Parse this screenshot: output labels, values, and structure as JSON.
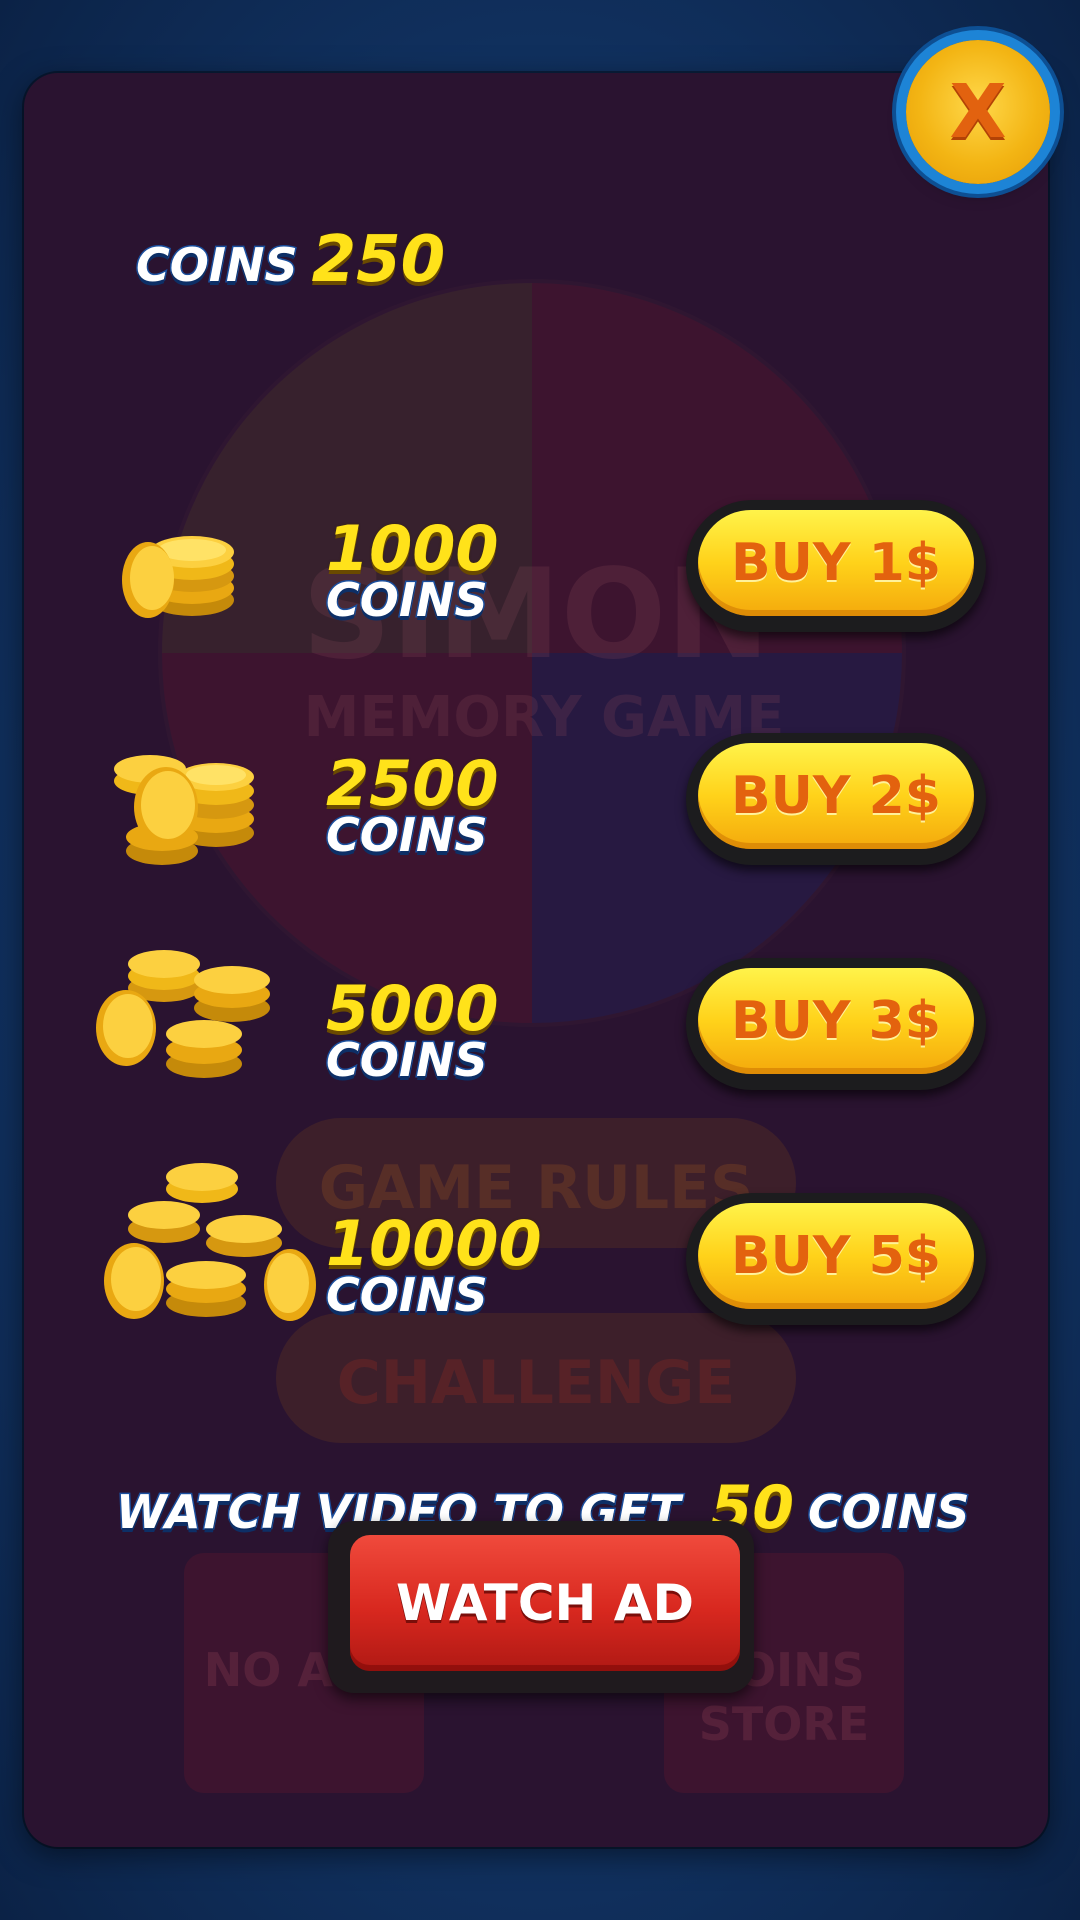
{
  "header": {
    "coins_label": "COINS",
    "coins_value": "250"
  },
  "close_button": {
    "label": "X"
  },
  "packs": [
    {
      "amount": "1000",
      "unit": "COINS",
      "button": "BUY 1$",
      "icon": "small-coin-stack-icon"
    },
    {
      "amount": "2500",
      "unit": "COINS",
      "button": "BUY 2$",
      "icon": "coin-stacks-icon"
    },
    {
      "amount": "5000",
      "unit": "COINS",
      "button": "BUY 3$",
      "icon": "coin-pile-icon"
    },
    {
      "amount": "10000",
      "unit": "COINS",
      "button": "BUY 5$",
      "icon": "large-coin-pile-icon"
    }
  ],
  "watch": {
    "prefix": "WATCH VIDEO TO GET",
    "amount": "50",
    "suffix": "COINS",
    "button": "WATCH AD"
  },
  "background_ghost": {
    "logo_line1": "SIMON",
    "logo_line2": "MEMORY GAME",
    "rules_button": "GAME RULES",
    "challenge_button": "CHALLENGE",
    "no_ads": "NO ADS",
    "coins_store": "COINS STORE"
  },
  "colors": {
    "panel": "#2a1330",
    "accent_yellow": "#ffe21a",
    "buy_text": "#e3620e",
    "watch_red": "#d8281f",
    "frame_blue": "#1d84d6"
  }
}
